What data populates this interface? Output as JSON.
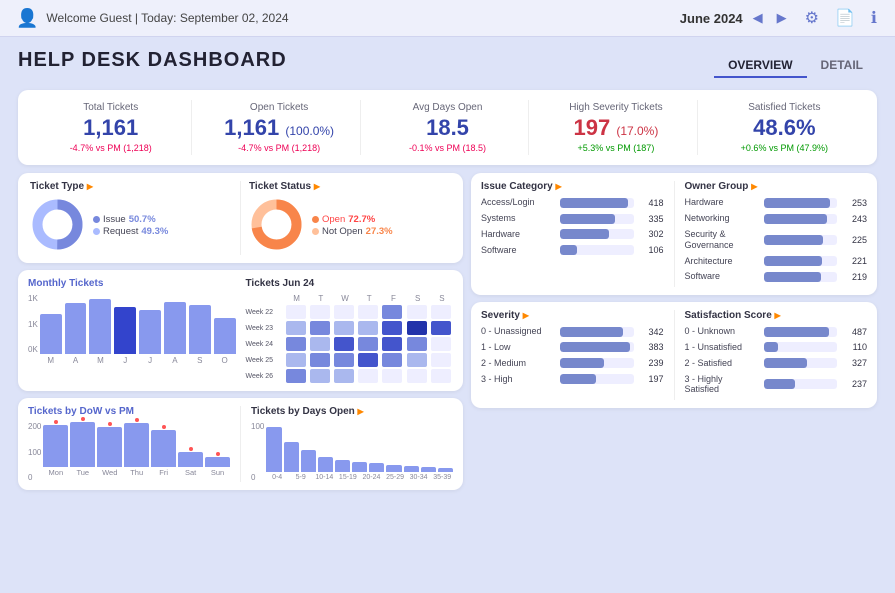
{
  "topbar": {
    "user": "Welcome Guest | Today: September 02, 2024",
    "month": "June 2024",
    "tabs": [
      "OVERVIEW",
      "DETAIL"
    ]
  },
  "title": "HELP DESK DASHBOARD",
  "kpis": [
    {
      "label": "Total Tickets",
      "value": "1,161",
      "change": "-4.7% vs PM (1,218)",
      "changeType": "neg"
    },
    {
      "label": "Open Tickets",
      "value": "1,161",
      "sub": "(100.0%)",
      "change": "-4.7% vs PM (1,218)",
      "changeType": "neg"
    },
    {
      "label": "Avg Days Open",
      "value": "18.5",
      "change": "-0.1% vs PM (18.5)",
      "changeType": "neg"
    },
    {
      "label": "High Severity Tickets",
      "value": "197",
      "sub": "(17.0%)",
      "change": "+5.3% vs PM (187)",
      "changeType": "pos"
    },
    {
      "label": "Satisfied Tickets",
      "value": "48.6%",
      "change": "+0.6% vs PM (47.9%)",
      "changeType": "pos"
    }
  ],
  "ticketType": {
    "title": "Ticket Type",
    "items": [
      {
        "label": "Issue",
        "pct": "50.7%",
        "color": "#7788dd"
      },
      {
        "label": "Request",
        "pct": "49.3%",
        "color": "#aabbff"
      }
    ]
  },
  "ticketStatus": {
    "title": "Ticket Status",
    "items": [
      {
        "label": "Open",
        "pct": "72.7%",
        "color": "#f8854a"
      },
      {
        "label": "Not Open",
        "pct": "27.3%",
        "color": "#ffc09a"
      }
    ]
  },
  "monthlyTickets": {
    "title": "Monthly Tickets",
    "yLabels": [
      "1K",
      "1K",
      "0K"
    ],
    "xLabels": [
      "M",
      "A",
      "M",
      "J",
      "J",
      "A",
      "S",
      "O"
    ],
    "bars": [
      55,
      70,
      75,
      65,
      60,
      72,
      68,
      50
    ]
  },
  "ticketsJun": {
    "title": "Tickets Jun 24",
    "days": [
      "M",
      "T",
      "W",
      "T",
      "F",
      "S",
      "S"
    ],
    "weeks": [
      "Week 22",
      "Week 23",
      "Week 24",
      "Week 25",
      "Week 26"
    ],
    "grid": [
      [
        0,
        0,
        0,
        0,
        2,
        0,
        0
      ],
      [
        1,
        2,
        1,
        1,
        3,
        4,
        3
      ],
      [
        2,
        1,
        3,
        2,
        3,
        2,
        0
      ],
      [
        1,
        2,
        2,
        3,
        2,
        1,
        0
      ],
      [
        2,
        1,
        1,
        0,
        0,
        0,
        0
      ]
    ]
  },
  "ticketsByDoW": {
    "title": "Tickets by DoW vs PM",
    "days": [
      "Mon",
      "Tue",
      "Wed",
      "Thu",
      "Fri",
      "Sat",
      "Sun"
    ],
    "bars": [
      85,
      90,
      80,
      88,
      75,
      30,
      20
    ],
    "yLabels": [
      "200",
      "100",
      "0"
    ]
  },
  "ticketsByDaysOpen": {
    "title": "Tickets by Days Open",
    "bars": [
      90,
      60,
      45,
      30,
      25,
      20,
      18,
      15,
      12,
      10,
      8
    ],
    "labels": [
      "0-4",
      "5-9",
      "10-14",
      "15-19",
      "20-24",
      "25-29",
      "30-34",
      "35-39"
    ],
    "yLabels": [
      "100",
      "0"
    ]
  },
  "issueCategory": {
    "title": "Issue Category",
    "items": [
      {
        "label": "Access/Login",
        "value": 418,
        "max": 450
      },
      {
        "label": "Systems",
        "value": 335,
        "max": 450
      },
      {
        "label": "Hardware",
        "value": 302,
        "max": 450
      },
      {
        "label": "Software",
        "value": 106,
        "max": 450
      }
    ]
  },
  "ownerGroup": {
    "title": "Owner Group",
    "items": [
      {
        "label": "Hardware",
        "value": 253,
        "max": 280
      },
      {
        "label": "Networking",
        "value": 243,
        "max": 280
      },
      {
        "label": "Security & Governance",
        "value": 225,
        "max": 280
      },
      {
        "label": "Architecture",
        "value": 221,
        "max": 280
      },
      {
        "label": "Software",
        "value": 219,
        "max": 280
      }
    ]
  },
  "severity": {
    "title": "Severity",
    "items": [
      {
        "label": "0 - Unassigned",
        "value": 342,
        "max": 400
      },
      {
        "label": "1 - Low",
        "value": 383,
        "max": 400
      },
      {
        "label": "2 - Medium",
        "value": 239,
        "max": 400
      },
      {
        "label": "3 - High",
        "value": 197,
        "max": 400
      }
    ]
  },
  "satisfactionScore": {
    "title": "Satisfaction Score",
    "items": [
      {
        "label": "0 - Unknown",
        "value": 487,
        "max": 550
      },
      {
        "label": "1 - Unsatisfied",
        "value": 110,
        "max": 550
      },
      {
        "label": "2 - Satisfied",
        "value": 327,
        "max": 550
      },
      {
        "label": "3 - Highly Satisfied",
        "value": 237,
        "max": 550
      }
    ]
  }
}
